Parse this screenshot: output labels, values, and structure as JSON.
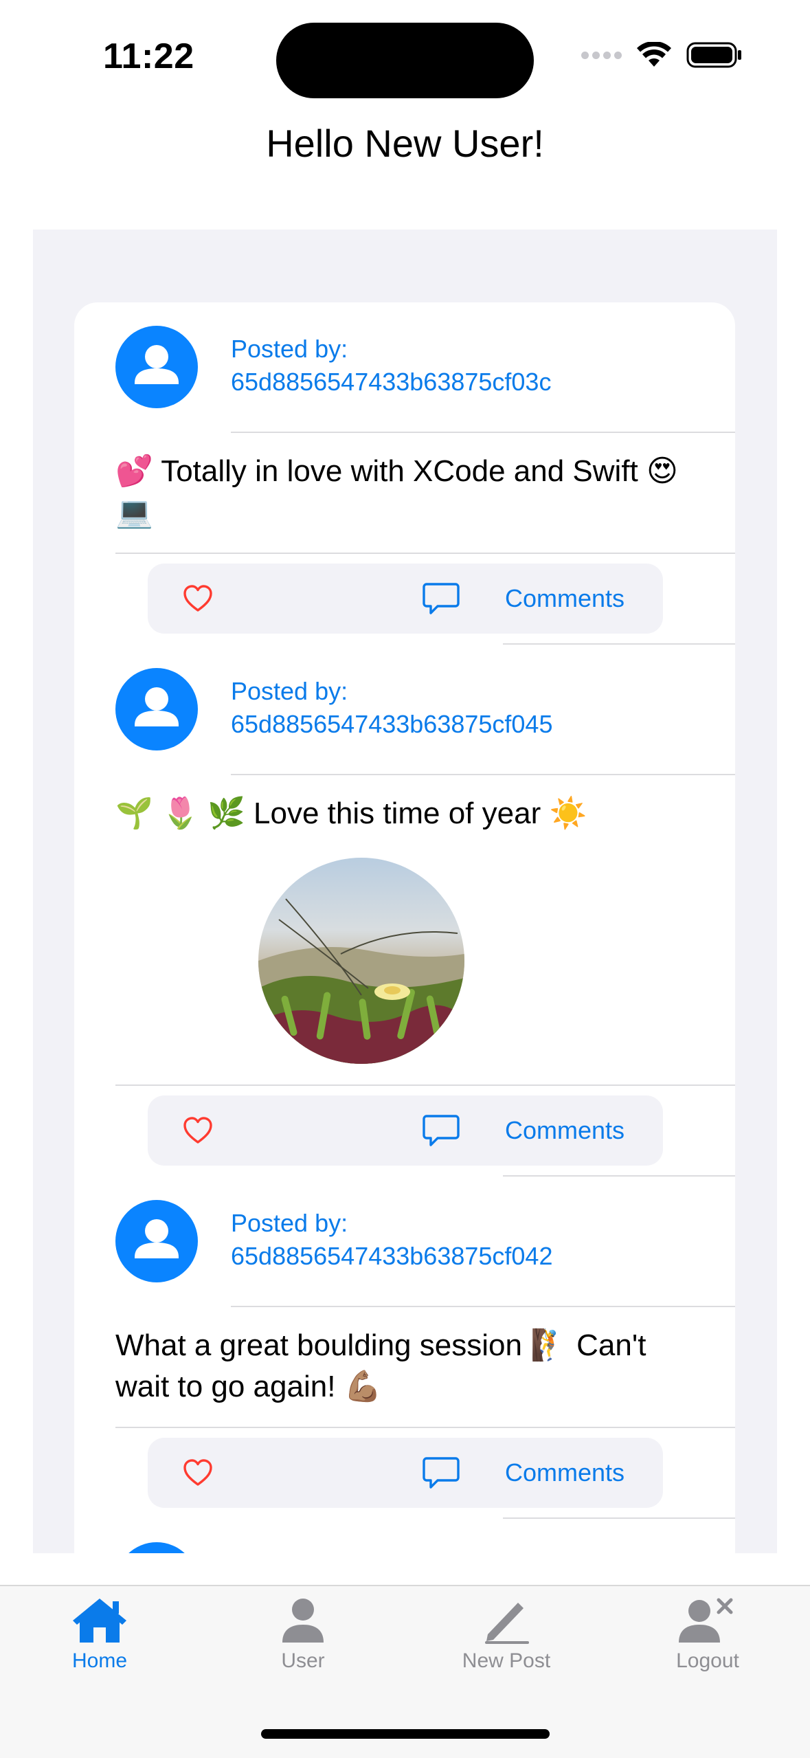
{
  "status_bar": {
    "time": "11:22"
  },
  "header": {
    "title": "Hello New User!"
  },
  "posts": [
    {
      "posted_by_label": "Posted by:",
      "author_id": "65d8856547433b63875cf03c",
      "text": "💕 Totally in love with XCode and Swift 😍 💻",
      "has_image": false,
      "comments_label": "Comments"
    },
    {
      "posted_by_label": "Posted by:",
      "author_id": "65d8856547433b63875cf045",
      "text": "🌱 🌷 🌿 Love this time of year ☀️",
      "has_image": true,
      "comments_label": "Comments"
    },
    {
      "posted_by_label": "Posted by:",
      "author_id": "65d8856547433b63875cf042",
      "text": "What a great boulding session 🧗 Can't wait to go again! 💪🏽",
      "has_image": false,
      "comments_label": "Comments"
    }
  ],
  "tab_bar": {
    "items": [
      {
        "label": "Home",
        "icon": "house-icon",
        "active": true
      },
      {
        "label": "User",
        "icon": "person-icon",
        "active": false
      },
      {
        "label": "New Post",
        "icon": "pencil-icon",
        "active": false
      },
      {
        "label": "Logout",
        "icon": "person-xmark-icon",
        "active": false
      }
    ]
  },
  "colors": {
    "accent": "#0a7bea",
    "avatar": "#0a84ff",
    "like": "#ff3b30",
    "panel_background": "#f2f2f7",
    "inactive_tab": "#8e8e93"
  }
}
